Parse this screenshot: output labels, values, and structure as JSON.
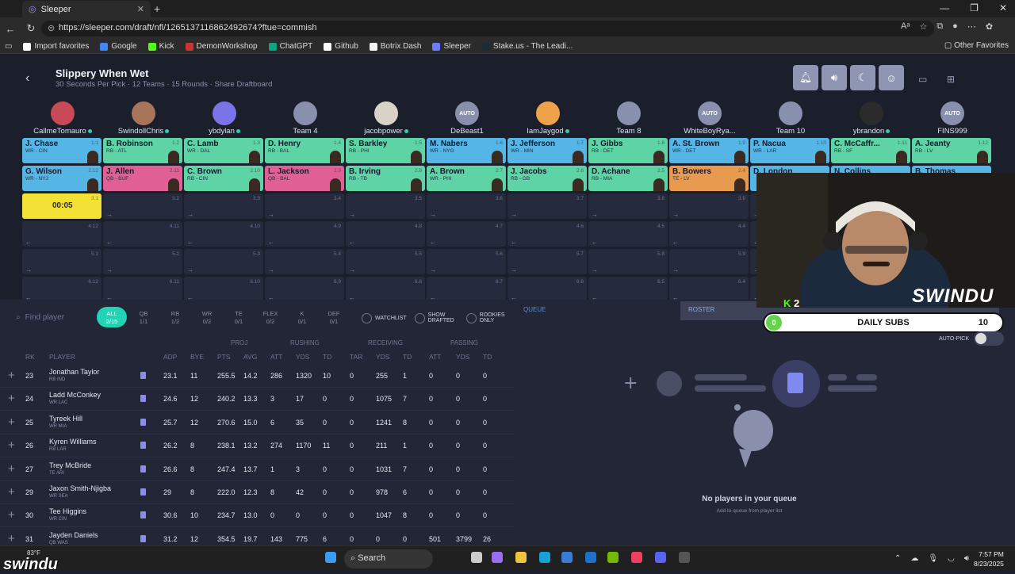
{
  "browser": {
    "tab_title": "Sleeper",
    "url": "https://sleeper.com/draft/nfl/1265137116862492674?ftue=commish",
    "bookmarks": [
      "Import favorites",
      "Google",
      "Kick",
      "DemonWorkshop",
      "ChatGPT",
      "Github",
      "Botrix Dash",
      "Sleeper",
      "Stake.us - The Leadi..."
    ],
    "bookmark_colors": [
      "#ffffff",
      "#4285f4",
      "#53fc18",
      "#c33",
      "#10a37f",
      "#ffffff",
      "#f5f5f5",
      "#6c7cff",
      "#1a2c38"
    ],
    "other_favorites": "Other Favorites"
  },
  "header": {
    "title": "Slippery When Wet",
    "subtitle": "30 Seconds Per Pick · 12 Teams · 15 Rounds · Share Draftboard"
  },
  "teams": [
    {
      "name": "CallmeTomauro",
      "online": true,
      "color": "#c94a57",
      "label": ""
    },
    {
      "name": "SwindollChris",
      "online": true,
      "color": "#a8745a",
      "label": ""
    },
    {
      "name": "ybdylan",
      "online": true,
      "color": "#7b73e8",
      "label": ""
    },
    {
      "name": "Team 4",
      "online": false,
      "color": "#8990ad",
      "label": ""
    },
    {
      "name": "jacobpower",
      "online": true,
      "color": "#d8d3c6",
      "label": ""
    },
    {
      "name": "DeBeast1",
      "online": false,
      "color": "#8990ad",
      "label": "AUTO"
    },
    {
      "name": "IamJaygod",
      "online": true,
      "color": "#f0a24a",
      "label": ""
    },
    {
      "name": "Team 8",
      "online": false,
      "color": "#8990ad",
      "label": ""
    },
    {
      "name": "WhiteBoyRya...",
      "online": false,
      "color": "#8990ad",
      "label": "AUTO"
    },
    {
      "name": "Team 10",
      "online": false,
      "color": "#8990ad",
      "label": ""
    },
    {
      "name": "ybrandon",
      "online": true,
      "color": "#2b2b2b",
      "label": ""
    },
    {
      "name": "FINS999",
      "online": false,
      "color": "#8990ad",
      "label": "AUTO"
    }
  ],
  "picks_round1": [
    {
      "name": "J. Chase",
      "info": "WR - CIN",
      "pick": "1.1",
      "pos": "wr"
    },
    {
      "name": "B. Robinson",
      "info": "RB - ATL",
      "pick": "1.2",
      "pos": "rb"
    },
    {
      "name": "C. Lamb",
      "info": "WR - DAL",
      "pick": "1.3",
      "pos": "rb"
    },
    {
      "name": "D. Henry",
      "info": "RB - BAL",
      "pick": "1.4",
      "pos": "rb"
    },
    {
      "name": "S. Barkley",
      "info": "RB - PHI",
      "pick": "1.5",
      "pos": "rb"
    },
    {
      "name": "M. Nabers",
      "info": "WR - NYG",
      "pick": "1.6",
      "pos": "wr"
    },
    {
      "name": "J. Jefferson",
      "info": "WR - MIN",
      "pick": "1.7",
      "pos": "wr"
    },
    {
      "name": "J. Gibbs",
      "info": "RB - DET",
      "pick": "1.8",
      "pos": "rb"
    },
    {
      "name": "A. St. Brown",
      "info": "WR - DET",
      "pick": "1.9",
      "pos": "wr"
    },
    {
      "name": "P. Nacua",
      "info": "WR - LAR",
      "pick": "1.10",
      "pos": "wr"
    },
    {
      "name": "C. McCaffr...",
      "info": "RB - SF",
      "pick": "1.11",
      "pos": "rb"
    },
    {
      "name": "A. Jeanty",
      "info": "RB - LV",
      "pick": "1.12",
      "pos": "rb"
    }
  ],
  "picks_round2": [
    {
      "name": "G. Wilson",
      "info": "WR - NYJ",
      "pick": "2.12",
      "pos": "wr"
    },
    {
      "name": "J. Allen",
      "info": "QB - BUF",
      "pick": "2.11",
      "pos": "qb"
    },
    {
      "name": "C. Brown",
      "info": "RB - CIN",
      "pick": "2.10",
      "pos": "rb"
    },
    {
      "name": "L. Jackson",
      "info": "QB - BAL",
      "pick": "2.9",
      "pos": "qb"
    },
    {
      "name": "B. Irving",
      "info": "RB - TB",
      "pick": "2.8",
      "pos": "rb"
    },
    {
      "name": "A. Brown",
      "info": "WR - PHI",
      "pick": "2.7",
      "pos": "rb"
    },
    {
      "name": "J. Jacobs",
      "info": "RB - GB",
      "pick": "2.6",
      "pos": "rb"
    },
    {
      "name": "D. Achane",
      "info": "RB - MIA",
      "pick": "2.5",
      "pos": "rb"
    },
    {
      "name": "B. Bowers",
      "info": "TE - LV",
      "pick": "2.4",
      "pos": "te"
    },
    {
      "name": "D. London",
      "info": "",
      "pick": "",
      "pos": "wr"
    },
    {
      "name": "N. Collins",
      "info": "",
      "pick": "",
      "pos": "wr"
    },
    {
      "name": "B. Thomas",
      "info": "",
      "pick": "",
      "pos": "wr"
    }
  ],
  "timer": "00:05",
  "empty_rounds": [
    [
      "3.1",
      "3.2",
      "3.3",
      "3.4",
      "3.5",
      "3.6",
      "3.7",
      "3.8",
      "3.9",
      "3.10",
      "3.11",
      "3.12"
    ],
    [
      "4.12",
      "4.11",
      "4.10",
      "4.9",
      "4.8",
      "4.7",
      "4.6",
      "4.5",
      "4.4",
      "4.3",
      "4.2",
      "4.1"
    ],
    [
      "5.1",
      "5.2",
      "5.3",
      "5.4",
      "5.5",
      "5.6",
      "5.7",
      "5.8",
      "5.9",
      "5.10",
      "5.11",
      "5.12"
    ],
    [
      "6.12",
      "6.11",
      "6.10",
      "6.9",
      "6.8",
      "6.7",
      "6.6",
      "6.5",
      "6.4",
      "6.3",
      "6.2",
      "6.1"
    ]
  ],
  "player_list": {
    "search_placeholder": "Find player",
    "pos_tabs": [
      {
        "label": "ALL",
        "count": "2/15",
        "active": true
      },
      {
        "label": "QB",
        "count": "1/1"
      },
      {
        "label": "RB",
        "count": "1/2"
      },
      {
        "label": "WR",
        "count": "0/2"
      },
      {
        "label": "TE",
        "count": "0/1"
      },
      {
        "label": "FLEX",
        "count": "0/2"
      },
      {
        "label": "K",
        "count": "0/1"
      },
      {
        "label": "DEF",
        "count": "0/1"
      }
    ],
    "filters": [
      "WATCHLIST",
      "SHOW DRAFTED",
      "ROOKIES ONLY"
    ],
    "groups": [
      "PROJ",
      "RUSHING",
      "RECEIVING",
      "PASSING"
    ],
    "columns": [
      "RK",
      "PLAYER",
      "ADP",
      "BYE",
      "PTS",
      "AVG",
      "ATT",
      "YDS",
      "TD",
      "TAR",
      "YDS",
      "TD",
      "ATT",
      "YDS",
      "TD"
    ],
    "players": [
      {
        "rk": "23",
        "name": "Jonathan Taylor",
        "sub": "RB IND",
        "adp": "23.1",
        "bye": "11",
        "pts": "255.5",
        "avg": "14.2",
        "ratt": "286",
        "ryds": "1320",
        "rtd": "10",
        "tar": "0",
        "cyds": "255",
        "ctd": "1",
        "patt": "0",
        "pyds": "0",
        "ptd": "0"
      },
      {
        "rk": "24",
        "name": "Ladd McConkey",
        "sub": "WR LAC",
        "adp": "24.6",
        "bye": "12",
        "pts": "240.2",
        "avg": "13.3",
        "ratt": "3",
        "ryds": "17",
        "rtd": "0",
        "tar": "0",
        "cyds": "1075",
        "ctd": "7",
        "patt": "0",
        "pyds": "0",
        "ptd": "0"
      },
      {
        "rk": "25",
        "name": "Tyreek Hill",
        "sub": "WR MIA",
        "adp": "25.7",
        "bye": "12",
        "pts": "270.6",
        "avg": "15.0",
        "ratt": "6",
        "ryds": "35",
        "rtd": "0",
        "tar": "0",
        "cyds": "1241",
        "ctd": "8",
        "patt": "0",
        "pyds": "0",
        "ptd": "0"
      },
      {
        "rk": "26",
        "name": "Kyren Williams",
        "sub": "RB LAR",
        "adp": "26.2",
        "bye": "8",
        "pts": "238.1",
        "avg": "13.2",
        "ratt": "274",
        "ryds": "1170",
        "rtd": "11",
        "tar": "0",
        "cyds": "211",
        "ctd": "1",
        "patt": "0",
        "pyds": "0",
        "ptd": "0"
      },
      {
        "rk": "27",
        "name": "Trey McBride",
        "sub": "TE ARI",
        "adp": "26.6",
        "bye": "8",
        "pts": "247.4",
        "avg": "13.7",
        "ratt": "1",
        "ryds": "3",
        "rtd": "0",
        "tar": "0",
        "cyds": "1031",
        "ctd": "7",
        "patt": "0",
        "pyds": "0",
        "ptd": "0"
      },
      {
        "rk": "29",
        "name": "Jaxon Smith-Njigba",
        "sub": "WR SEA",
        "adp": "29",
        "bye": "8",
        "pts": "222.0",
        "avg": "12.3",
        "ratt": "8",
        "ryds": "42",
        "rtd": "0",
        "tar": "0",
        "cyds": "978",
        "ctd": "6",
        "patt": "0",
        "pyds": "0",
        "ptd": "0"
      },
      {
        "rk": "30",
        "name": "Tee Higgins",
        "sub": "WR CIN",
        "adp": "30.6",
        "bye": "10",
        "pts": "234.7",
        "avg": "13.0",
        "ratt": "0",
        "ryds": "0",
        "rtd": "0",
        "tar": "0",
        "cyds": "1047",
        "ctd": "8",
        "patt": "0",
        "pyds": "0",
        "ptd": "0"
      },
      {
        "rk": "31",
        "name": "Jayden Daniels",
        "sub": "QB WAS",
        "adp": "31.2",
        "bye": "12",
        "pts": "354.5",
        "avg": "19.7",
        "ratt": "143",
        "ryds": "775",
        "rtd": "6",
        "tar": "0",
        "cyds": "0",
        "ctd": "0",
        "patt": "501",
        "pyds": "3799",
        "ptd": "26"
      }
    ]
  },
  "queue": {
    "label": "QUEUE",
    "empty_title": "No players in your queue",
    "empty_sub": "Add to queue from player list"
  },
  "roster_label": "ROSTER",
  "overlay": {
    "kick_count": "2",
    "subs_label": "DAILY SUBS",
    "subs_left": "0",
    "subs_right": "10",
    "brand": "SWINDU",
    "auto_pick": "AUTO-PICK",
    "watermark": "swindu"
  },
  "taskbar": {
    "weather": "83°F",
    "search": "Search",
    "time": "7:57 PM",
    "date": "8/23/2025"
  }
}
